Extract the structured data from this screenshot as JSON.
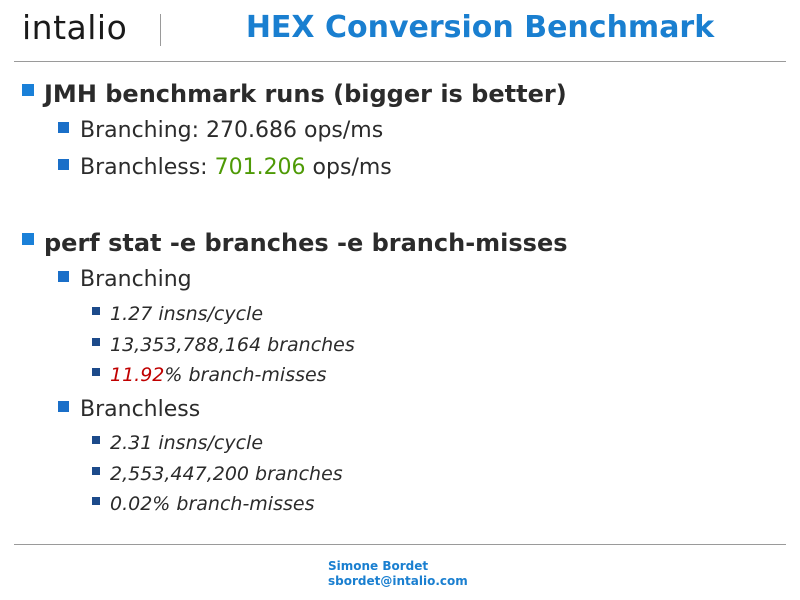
{
  "header": {
    "logo_text": "intalio",
    "title": "HEX Conversion Benchmark"
  },
  "sections": {
    "jmh": {
      "heading": "JMH benchmark runs (bigger is better)",
      "branching": {
        "prefix": "Branching: ",
        "value": "270.686",
        "unit": " ops/ms"
      },
      "branchless": {
        "prefix": "Branchless: ",
        "value": "701.206",
        "unit": " ops/ms",
        "value_color": "#4e9a06"
      }
    },
    "perf": {
      "heading": "perf stat -e branches -e branch-misses",
      "branching": {
        "label": "Branching",
        "items": [
          "1.27 insns/cycle",
          "13,353,788,164 branches"
        ],
        "misses_value": "11.92",
        "misses_suffix": "% branch-misses",
        "misses_color": "#c00000"
      },
      "branchless": {
        "label": "Branchless",
        "items": [
          "2.31 insns/cycle",
          "2,553,447,200 branches",
          "0.02% branch-misses"
        ]
      }
    }
  },
  "footer": {
    "author": "Simone Bordet",
    "email": "sbordet@intalio.com"
  },
  "colors": {
    "title": "#1a7fd0",
    "bullet_l1": "#1a80d8",
    "bullet_l3": "#1c4a8a"
  }
}
